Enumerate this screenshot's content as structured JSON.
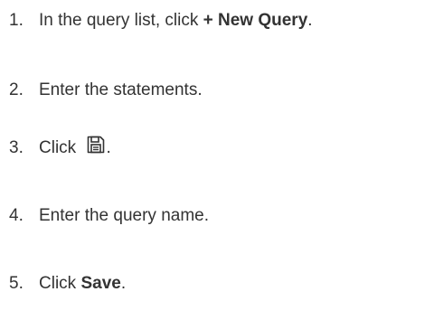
{
  "steps": [
    {
      "number": "1.",
      "text_before": "In the query list, click ",
      "bold": "+ New Query",
      "text_after": "."
    },
    {
      "number": "2.",
      "text": "Enter the statements."
    },
    {
      "number": "3.",
      "text_before": "Click ",
      "icon": "save-icon",
      "text_after": "."
    },
    {
      "number": "4.",
      "text": "Enter the query name."
    },
    {
      "number": "5.",
      "text_before": "Click ",
      "bold": "Save",
      "text_after": "."
    }
  ],
  "colors": {
    "text": "#333333",
    "icon_stroke": "#333333"
  }
}
